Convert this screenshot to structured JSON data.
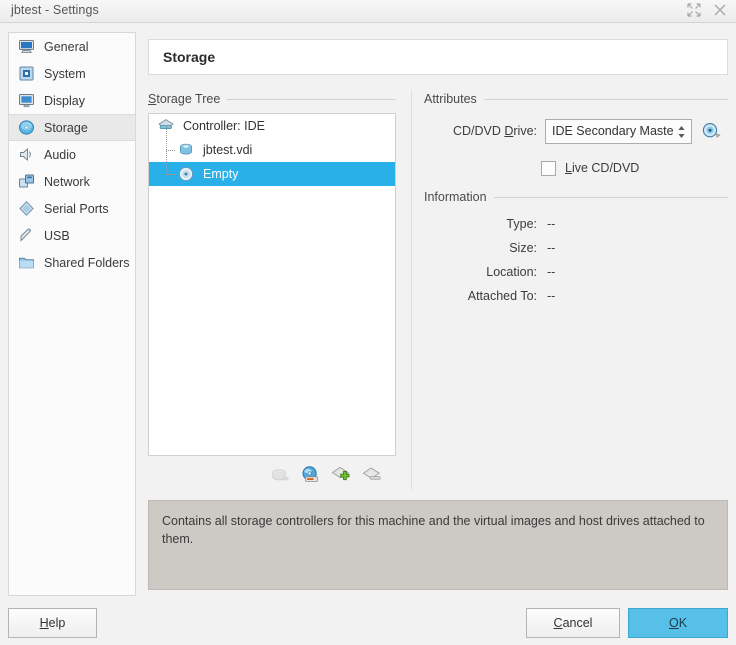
{
  "window": {
    "title": "jbtest - Settings",
    "buttons": [
      {
        "name": "maximize-icon",
        "label": "Maximize"
      },
      {
        "name": "close-icon",
        "label": "Close"
      }
    ]
  },
  "sidebar": {
    "items": [
      {
        "label": "General",
        "icon": "monitor-icon",
        "selected": false
      },
      {
        "label": "System",
        "icon": "chip-icon",
        "selected": false
      },
      {
        "label": "Display",
        "icon": "display-icon",
        "selected": false
      },
      {
        "label": "Storage",
        "icon": "storage-disc-icon",
        "selected": true
      },
      {
        "label": "Audio",
        "icon": "speaker-icon",
        "selected": false
      },
      {
        "label": "Network",
        "icon": "network-cards-icon",
        "selected": false
      },
      {
        "label": "Serial Ports",
        "icon": "serial-port-icon",
        "selected": false
      },
      {
        "label": "USB",
        "icon": "usb-plug-icon",
        "selected": false
      },
      {
        "label": "Shared Folders",
        "icon": "folder-icon",
        "selected": false
      }
    ]
  },
  "header": {
    "title": "Storage"
  },
  "storage_tree": {
    "group_title": "Storage Tree",
    "group_title_mnemonic": "S",
    "nodes": [
      {
        "label": "Controller: IDE",
        "icon": "controller-ide-icon",
        "level": 0,
        "selected": false
      },
      {
        "label": "jbtest.vdi",
        "icon": "hard-disk-icon",
        "level": 1,
        "selected": false
      },
      {
        "label": "Empty",
        "icon": "cd-dvd-icon",
        "level": 1,
        "selected": true
      }
    ],
    "toolbar": [
      {
        "name": "add-hard-disk-button",
        "label": "Add Hard Disk",
        "disabled": true
      },
      {
        "name": "add-cd-dvd-button",
        "label": "Add CD/DVD Device",
        "disabled": false
      },
      {
        "name": "add-controller-button",
        "label": "Add Controller",
        "disabled": false
      },
      {
        "name": "remove-controller-button",
        "label": "Remove Controller",
        "disabled": false
      }
    ]
  },
  "attributes": {
    "group_title": "Attributes",
    "cd_drive_label": "CD/DVD Drive:",
    "cd_drive_mnemonic": "D",
    "cd_drive_value": "IDE Secondary Maste",
    "cd_drive_icon": "cd-dvd-select-icon",
    "live_checkbox_label": "Live CD/DVD",
    "live_checkbox_mnemonic": "L",
    "live_checkbox_checked": false
  },
  "information": {
    "group_title": "Information",
    "rows": [
      {
        "label": "Type:",
        "value": "--"
      },
      {
        "label": "Size:",
        "value": "--"
      },
      {
        "label": "Location:",
        "value": "--"
      },
      {
        "label": "Attached To:",
        "value": "--"
      }
    ]
  },
  "description": {
    "text": "Contains all storage controllers for this machine and the virtual images and host drives attached to them."
  },
  "footer": {
    "help_label": "Help",
    "help_mnemonic": "H",
    "cancel_label": "Cancel",
    "cancel_mnemonic": "C",
    "ok_label": "OK",
    "ok_mnemonic": "O"
  },
  "colors": {
    "selection_blue": "#29b0e8",
    "ok_button_blue": "#56c0e8",
    "sidebar_selected": "#e9e9e9",
    "description_bg": "#cdc9c4",
    "dialog_bg": "#f2f2f2"
  }
}
